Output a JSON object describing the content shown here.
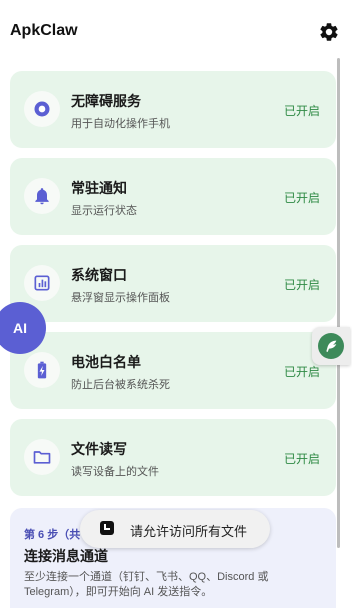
{
  "app": {
    "title": "ApkClaw"
  },
  "header": {
    "settings_icon": "gear-icon"
  },
  "permissions": [
    {
      "icon": "accessibility-icon",
      "title": "无障碍服务",
      "desc": "用于自动化操作手机",
      "status": "已开启"
    },
    {
      "icon": "bell-icon",
      "title": "常驻通知",
      "desc": "显示运行状态",
      "status": "已开启"
    },
    {
      "icon": "chart-window-icon",
      "title": "系统窗口",
      "desc": "悬浮窗显示操作面板",
      "status": "已开启"
    },
    {
      "icon": "battery-icon",
      "title": "电池白名单",
      "desc": "防止后台被系统杀死",
      "status": "已开启"
    },
    {
      "icon": "folder-icon",
      "title": "文件读写",
      "desc": "读写设备上的文件",
      "status": "已开启"
    }
  ],
  "step": {
    "label": "第 6 步（共",
    "title": "连接消息通道",
    "desc": "至少连接一个通道（钉钉、飞书、QQ、Discord 或 Telegram），即可开始向 AI 发送指令。"
  },
  "toast": {
    "icon": "app-icon",
    "text": "请允许访问所有文件"
  },
  "fab": {
    "label": "AI"
  },
  "floating_button": {
    "icon": "feather-icon"
  },
  "colors": {
    "card_bg": "#e7f5ea",
    "status_green": "#2f8a45",
    "accent_purple": "#5b5fd3",
    "step_bg": "#eef0fb"
  }
}
